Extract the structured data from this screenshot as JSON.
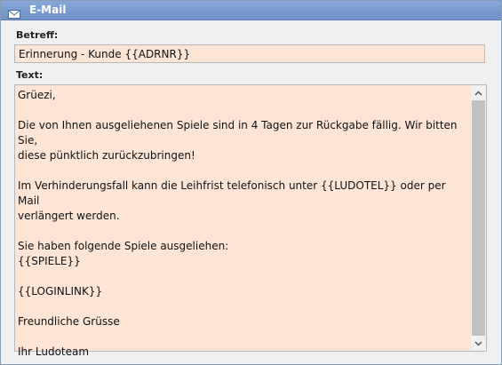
{
  "window": {
    "title": "E-Mail",
    "icon": "envelope-icon"
  },
  "subject": {
    "label": "Betreff:",
    "value": "Erinnerung - Kunde {{ADRNR}}"
  },
  "body": {
    "label": "Text:",
    "lines": [
      "Grüezi,",
      "",
      "Die von Ihnen ausgeliehenen Spiele sind in 4 Tagen zur Rückgabe fällig. Wir bitten Sie,",
      "diese pünktlich zurückzubringen!",
      "",
      "Im Verhinderungsfall kann die Leihfrist telefonisch unter {{LUDOTEL}} oder per Mail",
      "verlängert werden.",
      "",
      "Sie haben folgende Spiele ausgeliehen:",
      "{{SPIELE}}",
      "",
      "{{LOGINLINK}}",
      "",
      "Freundliche Grüsse",
      "",
      "Ihr Ludoteam"
    ]
  },
  "colors": {
    "titlebar": "#7799cc",
    "field_background": "#fde5d5",
    "scroll_thumb": "#c2c2c2"
  }
}
